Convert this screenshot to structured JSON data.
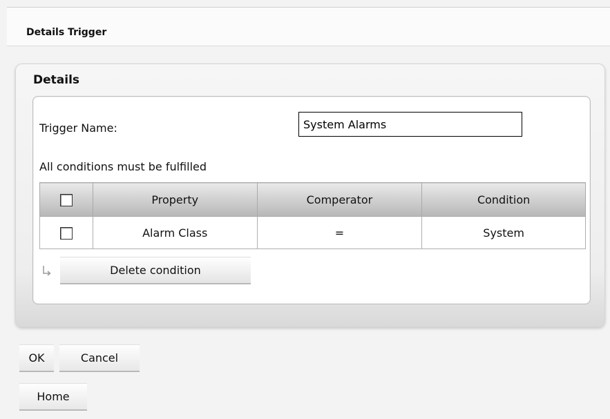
{
  "window": {
    "title": "Details Trigger"
  },
  "details": {
    "section_title": "Details",
    "trigger_name_label": "Trigger Name:",
    "trigger_name_value": "System Alarms",
    "conditions_label": "All conditions must be fulfilled",
    "table": {
      "columns": [
        "Property",
        "Comperator",
        "Condition"
      ],
      "rows": [
        {
          "property": "Alarm Class",
          "comperator": "=",
          "condition": "System",
          "checked": false
        }
      ]
    },
    "delete_label": "Delete condition"
  },
  "buttons": {
    "ok": "OK",
    "cancel": "Cancel",
    "home": "Home"
  },
  "icons": {
    "select_all": "checkbox-icon",
    "row_select": "checkbox-icon",
    "action_arrow": "arrow-down-right-icon"
  },
  "colors": {
    "header_top": "#e9e9e9",
    "header_bottom": "#b7b7b7",
    "panel_bg": "#eeeeee"
  }
}
